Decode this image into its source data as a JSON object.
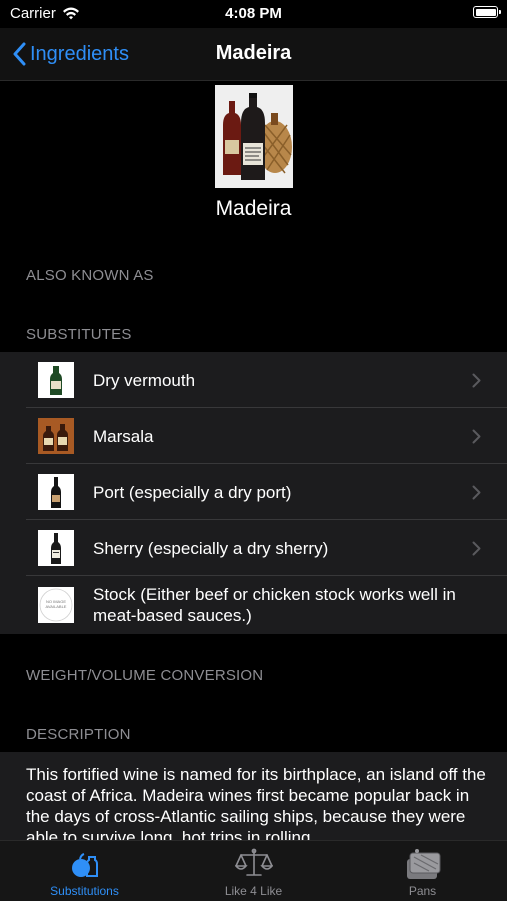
{
  "status": {
    "carrier": "Carrier",
    "time": "4:08 PM"
  },
  "nav": {
    "back_label": "Ingredients",
    "title": "Madeira"
  },
  "hero": {
    "name": "Madeira"
  },
  "sections": {
    "aka": "ALSO KNOWN AS",
    "substitutes": "SUBSTITUTES",
    "conversion": "WEIGHT/VOLUME CONVERSION",
    "description": "DESCRIPTION"
  },
  "substitutes": [
    {
      "label": "Dry vermouth",
      "icon": "vermouth-bottle-thumbnail",
      "has_disclosure": true
    },
    {
      "label": "Marsala",
      "icon": "marsala-bottles-thumbnail",
      "has_disclosure": true
    },
    {
      "label": "Port (especially a dry port)",
      "icon": "port-bottle-thumbnail",
      "has_disclosure": true
    },
    {
      "label": "Sherry (especially a dry sherry)",
      "icon": "sherry-bottle-thumbnail",
      "has_disclosure": true
    },
    {
      "label": "Stock (Either beef or chicken stock works well in meat-based sauces.)",
      "icon": "no-image-thumbnail",
      "has_disclosure": false
    }
  ],
  "no_image_text": "NO IMAGE AVAILABLE",
  "description": "This fortified wine is named for its birthplace, an island off the coast of Africa.   Madeira wines first became popular back in the days of cross-Atlantic sailing ships, because they were able to survive long, hot trips in rolling",
  "tabs": [
    {
      "label": "Substitutions",
      "icon": "substitutions-icon",
      "active": true
    },
    {
      "label": "Like 4 Like",
      "icon": "scale-icon",
      "active": false
    },
    {
      "label": "Pans",
      "icon": "pans-icon",
      "active": false
    }
  ],
  "colors": {
    "accent": "#2f8ff7",
    "background": "#000000",
    "cell": "#1c1c1e",
    "secondary_text": "#8e8e93"
  }
}
